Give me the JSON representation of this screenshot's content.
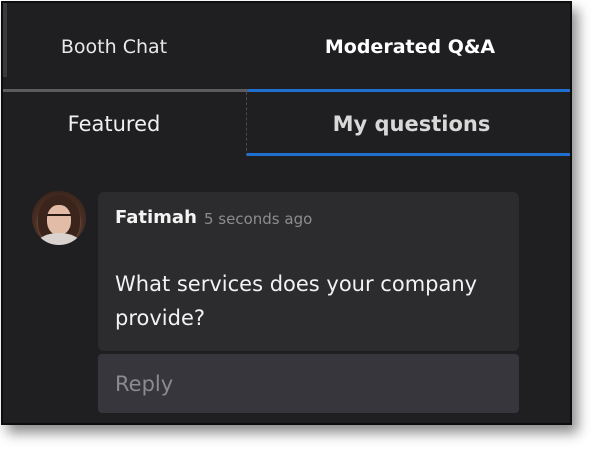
{
  "tabs": {
    "main": [
      {
        "label": "Booth Chat",
        "active": false
      },
      {
        "label": "Moderated Q&A",
        "active": true
      }
    ],
    "sub": [
      {
        "label": "Featured",
        "active": false
      },
      {
        "label": "My questions",
        "active": true
      }
    ]
  },
  "message": {
    "author": "Fatimah",
    "timestamp": "5 seconds ago",
    "text": "What services does your company provide?",
    "avatar_icon": "user-avatar-photo"
  },
  "reply": {
    "placeholder": "Reply"
  },
  "colors": {
    "background": "#1f1f21",
    "card": "#2c2c2e",
    "reply_field": "#36363c",
    "accent": "#1f6fd1",
    "inactive_underline": "#5c5c5e"
  }
}
